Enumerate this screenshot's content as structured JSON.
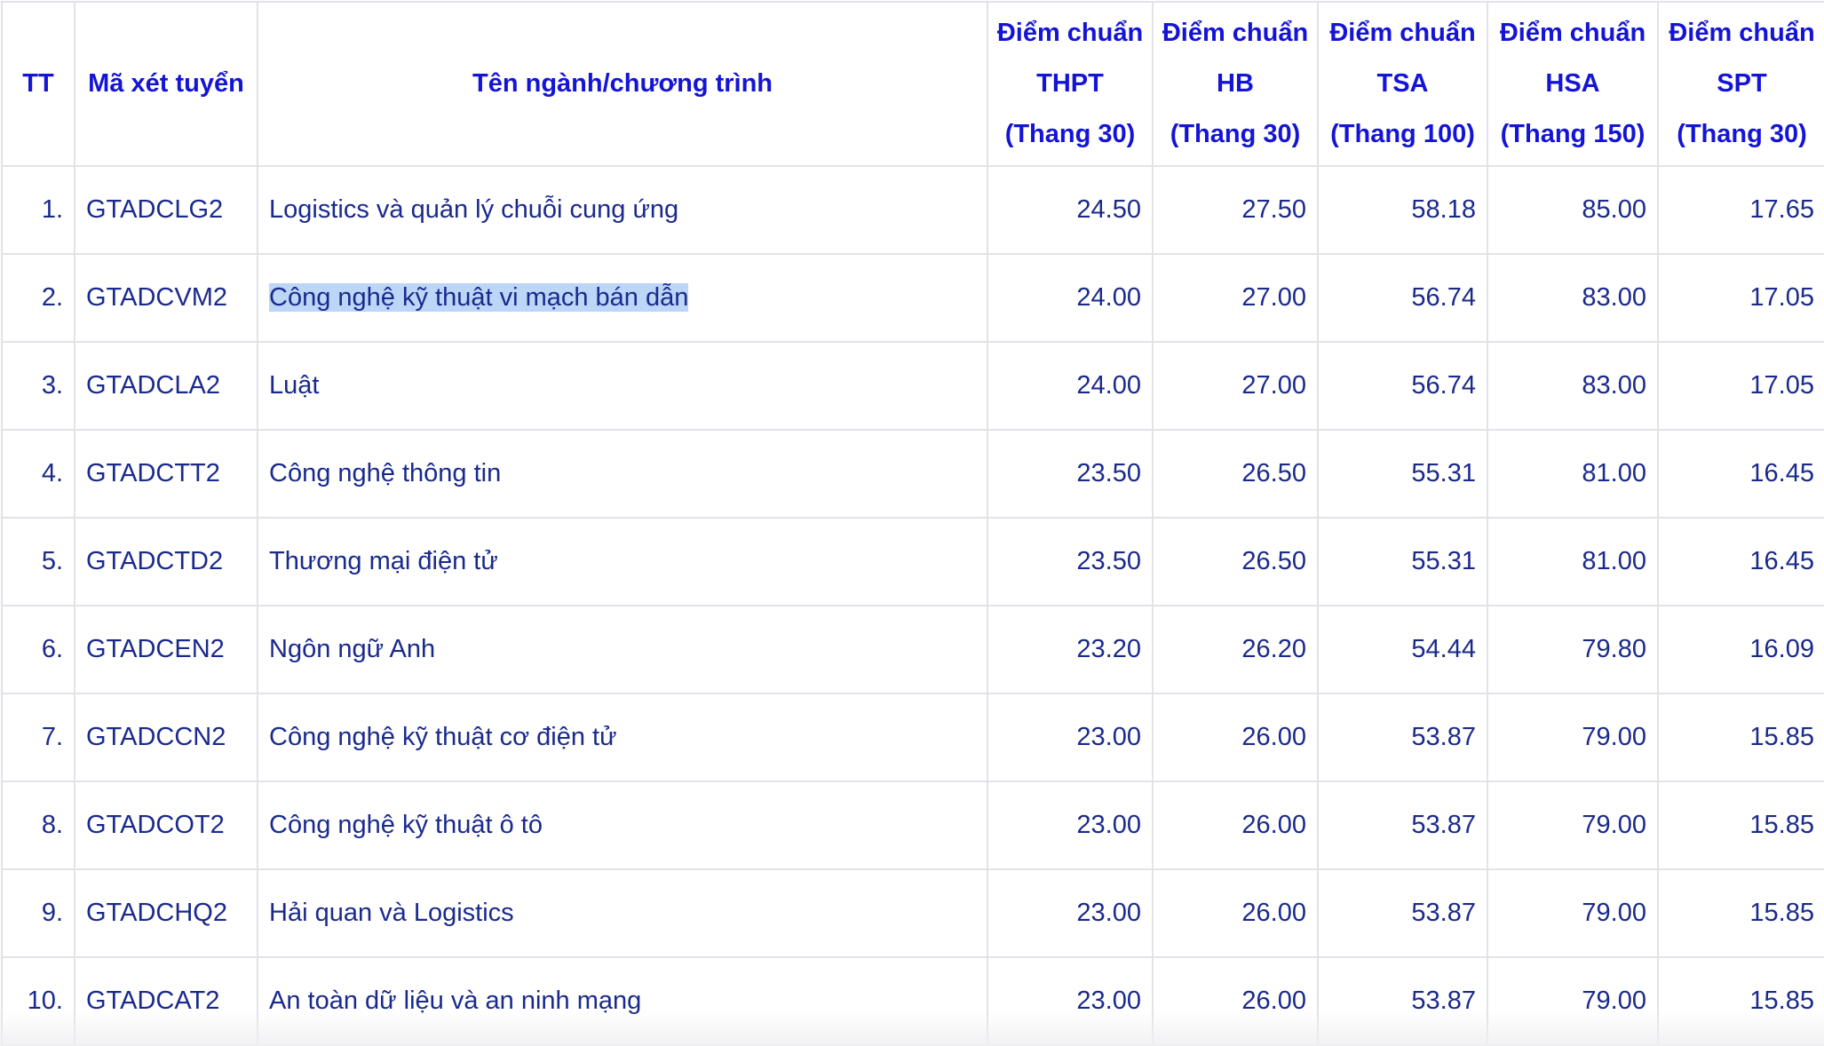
{
  "table": {
    "headers": {
      "tt": "TT",
      "code": "Mã xét tuyển",
      "name": "Tên ngành/chương trình",
      "thpt": [
        "Điểm chuẩn",
        "THPT",
        "(Thang 30)"
      ],
      "hb": [
        "Điểm chuẩn",
        "HB",
        "(Thang 30)"
      ],
      "tsa": [
        "Điểm chuẩn",
        "TSA",
        "(Thang 100)"
      ],
      "hsa": [
        "Điểm chuẩn",
        "HSA",
        "(Thang 150)"
      ],
      "spt": [
        "Điểm chuẩn",
        "SPT",
        "(Thang 30)"
      ]
    },
    "rows": [
      {
        "tt": "1.",
        "code": "GTADCLG2",
        "name": "Logistics và quản lý chuỗi cung ứng",
        "thpt": "24.50",
        "hb": "27.50",
        "tsa": "58.18",
        "hsa": "85.00",
        "spt": "17.65"
      },
      {
        "tt": "2.",
        "code": "GTADCVM2",
        "name": "Công nghệ kỹ thuật vi mạch bán dẫn",
        "thpt": "24.00",
        "hb": "27.00",
        "tsa": "56.74",
        "hsa": "83.00",
        "spt": "17.05"
      },
      {
        "tt": "3.",
        "code": "GTADCLA2",
        "name": "Luật",
        "thpt": "24.00",
        "hb": "27.00",
        "tsa": "56.74",
        "hsa": "83.00",
        "spt": "17.05"
      },
      {
        "tt": "4.",
        "code": "GTADCTT2",
        "name": "Công nghệ thông tin",
        "thpt": "23.50",
        "hb": "26.50",
        "tsa": "55.31",
        "hsa": "81.00",
        "spt": "16.45"
      },
      {
        "tt": "5.",
        "code": "GTADCTD2",
        "name": "Thương mại điện tử",
        "thpt": "23.50",
        "hb": "26.50",
        "tsa": "55.31",
        "hsa": "81.00",
        "spt": "16.45"
      },
      {
        "tt": "6.",
        "code": "GTADCEN2",
        "name": "Ngôn ngữ Anh",
        "thpt": "23.20",
        "hb": "26.20",
        "tsa": "54.44",
        "hsa": "79.80",
        "spt": "16.09"
      },
      {
        "tt": "7.",
        "code": "GTADCCN2",
        "name": "Công nghệ kỹ thuật cơ điện tử",
        "thpt": "23.00",
        "hb": "26.00",
        "tsa": "53.87",
        "hsa": "79.00",
        "spt": "15.85"
      },
      {
        "tt": "8.",
        "code": "GTADCOT2",
        "name": "Công nghệ kỹ thuật ô tô",
        "thpt": "23.00",
        "hb": "26.00",
        "tsa": "53.87",
        "hsa": "79.00",
        "spt": "15.85"
      },
      {
        "tt": "9.",
        "code": "GTADCHQ2",
        "name": "Hải quan và Logistics",
        "thpt": "23.00",
        "hb": "26.00",
        "tsa": "53.87",
        "hsa": "79.00",
        "spt": "15.85"
      },
      {
        "tt": "10.",
        "code": "GTADCAT2",
        "name": "An toàn dữ liệu và an ninh mạng",
        "thpt": "23.00",
        "hb": "26.00",
        "tsa": "53.87",
        "hsa": "79.00",
        "spt": "15.85"
      }
    ]
  },
  "colors": {
    "header_text": "#1414d6",
    "body_text": "#1a2a8c",
    "grid": "#e1e3e8",
    "selection": "#bcd6f7"
  }
}
